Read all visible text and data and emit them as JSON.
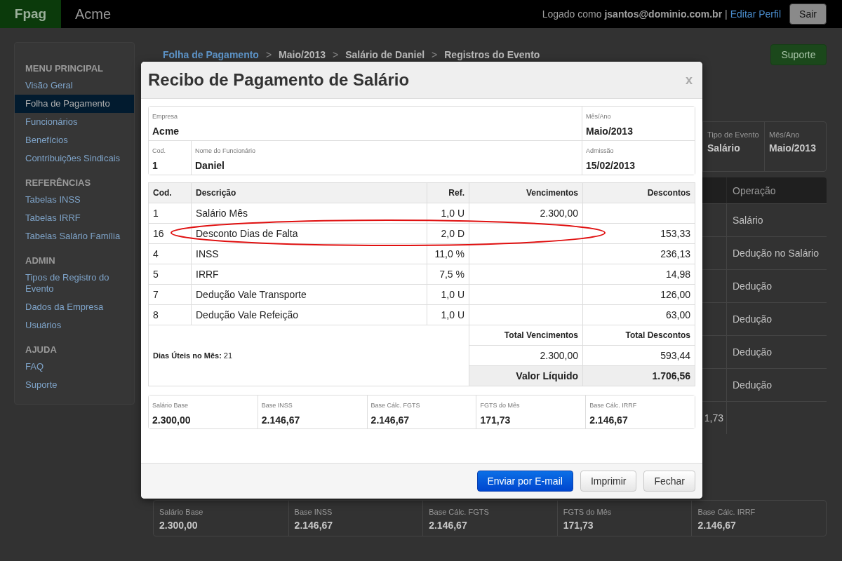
{
  "topbar": {
    "brand": "Fpag",
    "app": "Acme",
    "login_text": "Logado como **jsantos@dominio.com.br**",
    "separator": "|",
    "profile_link": "Editar Perfil",
    "logout": "Sair"
  },
  "sidebar": {
    "sections": [
      {
        "title": "MENU PRINCIPAL",
        "items": [
          {
            "label": "Visão Geral",
            "selected": false
          },
          {
            "label": "Folha de Pagamento",
            "selected": true
          },
          {
            "label": "Funcionários",
            "selected": false
          },
          {
            "label": "Benefícios",
            "selected": false
          },
          {
            "label": "Contribuições Sindicais",
            "selected": false
          }
        ]
      },
      {
        "title": "REFERÊNCIAS",
        "items": [
          {
            "label": "Tabelas INSS",
            "selected": false
          },
          {
            "label": "Tabelas IRRF",
            "selected": false
          },
          {
            "label": "Tabelas Salário Família",
            "selected": false
          }
        ]
      },
      {
        "title": "ADMIN",
        "items": [
          {
            "label": "Tipos de Registro do Evento",
            "selected": false
          },
          {
            "label": "Dados da Empresa",
            "selected": false
          },
          {
            "label": "Usuários",
            "selected": false
          }
        ]
      },
      {
        "title": "AJUDA",
        "items": [
          {
            "label": "FAQ",
            "selected": false
          },
          {
            "label": "Suporte",
            "selected": false
          }
        ]
      }
    ]
  },
  "breadcrumb": {
    "separator": ">",
    "items": [
      {
        "label": "Folha de Pagamento",
        "kind": "link"
      },
      {
        "label": "Maio/2013",
        "kind": "text"
      },
      {
        "label": "Salário de Daniel",
        "kind": "text"
      },
      {
        "label": "Registros do Evento",
        "kind": "text"
      }
    ]
  },
  "support_button": "Suporte",
  "event_info": [
    {
      "label": "Tipo de Evento",
      "value": "Salário"
    },
    {
      "label": "Mês/Ano",
      "value": "Maio/2013"
    }
  ],
  "event_table": {
    "columns": [
      "Operação"
    ],
    "rows": [
      {
        "operation": "Salário"
      },
      {
        "operation": "Dedução no Salário"
      },
      {
        "operation": "Dedução"
      },
      {
        "operation": "Dedução"
      },
      {
        "operation": "Dedução"
      },
      {
        "operation": "Dedução"
      },
      {
        "column_1": "1,73"
      }
    ]
  },
  "event_summary": [
    {
      "label": "Salário Base",
      "value": "2.300,00"
    },
    {
      "label": "Base INSS",
      "value": "2.146,67"
    },
    {
      "label": "Base Cálc. FGTS",
      "value": "2.146,67"
    },
    {
      "label": "FGTS do Mês",
      "value": "171,73"
    },
    {
      "label": "Base Cálc. IRRF",
      "value": "2.146,67"
    }
  ],
  "modal": {
    "title": "Recibo de Pagamento de Salário",
    "close": "x",
    "fields": [
      [
        {
          "label": "Empresa",
          "value": "Acme"
        },
        {
          "label": "Mês/Ano",
          "value": "Maio/2013"
        }
      ],
      [
        {
          "label": "Cod.",
          "value": "1"
        },
        {
          "label": "Nome do Funcionário",
          "value": "Daniel"
        },
        {
          "label": "Admissão",
          "value": "15/02/2013"
        }
      ]
    ],
    "items": {
      "columns": [
        "Cod.",
        "Descrição",
        "Ref.",
        "Vencimentos",
        "Descontos"
      ],
      "rows": [
        {
          "code": "1",
          "description": "Salário Mês",
          "ref": "1,0 U",
          "earnings": "2.300,00",
          "circled": false
        },
        {
          "code": "16",
          "description": "Desconto Dias de Falta",
          "ref": "2,0 D",
          "deductions": "153,33",
          "circled": true
        },
        {
          "code": "4",
          "description": "INSS",
          "ref": "11,0 %",
          "deductions": "236,13",
          "circled": false
        },
        {
          "code": "5",
          "description": "IRRF",
          "ref": "7,5 %",
          "deductions": "14,98",
          "circled": false
        },
        {
          "code": "7",
          "description": "Dedução Vale Transporte",
          "ref": "1,0 U",
          "deductions": "126,00",
          "circled": false
        },
        {
          "code": "8",
          "description": "Dedução Vale Refeição",
          "ref": "1,0 U",
          "deductions": "63,00",
          "circled": false
        }
      ]
    },
    "days_text": "**Dias Úteis no Mês:** 21",
    "totals": {
      "earnings_label": "Total Vencimentos",
      "deductions_label": "Total Descontos",
      "earnings": "2.300,00",
      "deductions": "593,44",
      "net_label": "Valor Líquido",
      "net": "1.706,56"
    },
    "summary": [
      {
        "label": "Salário Base",
        "value": "2.300,00"
      },
      {
        "label": "Base INSS",
        "value": "2.146,67"
      },
      {
        "label": "Base Cálc. FGTS",
        "value": "2.146,67"
      },
      {
        "label": "FGTS do Mês",
        "value": "171,73"
      },
      {
        "label": "Base Cálc. IRRF",
        "value": "2.146,67"
      }
    ],
    "buttons": [
      {
        "label": "Enviar por E-mail",
        "kind": "primary"
      },
      {
        "label": "Imprimir",
        "kind": "default"
      },
      {
        "label": "Fechar",
        "kind": "default"
      }
    ]
  }
}
